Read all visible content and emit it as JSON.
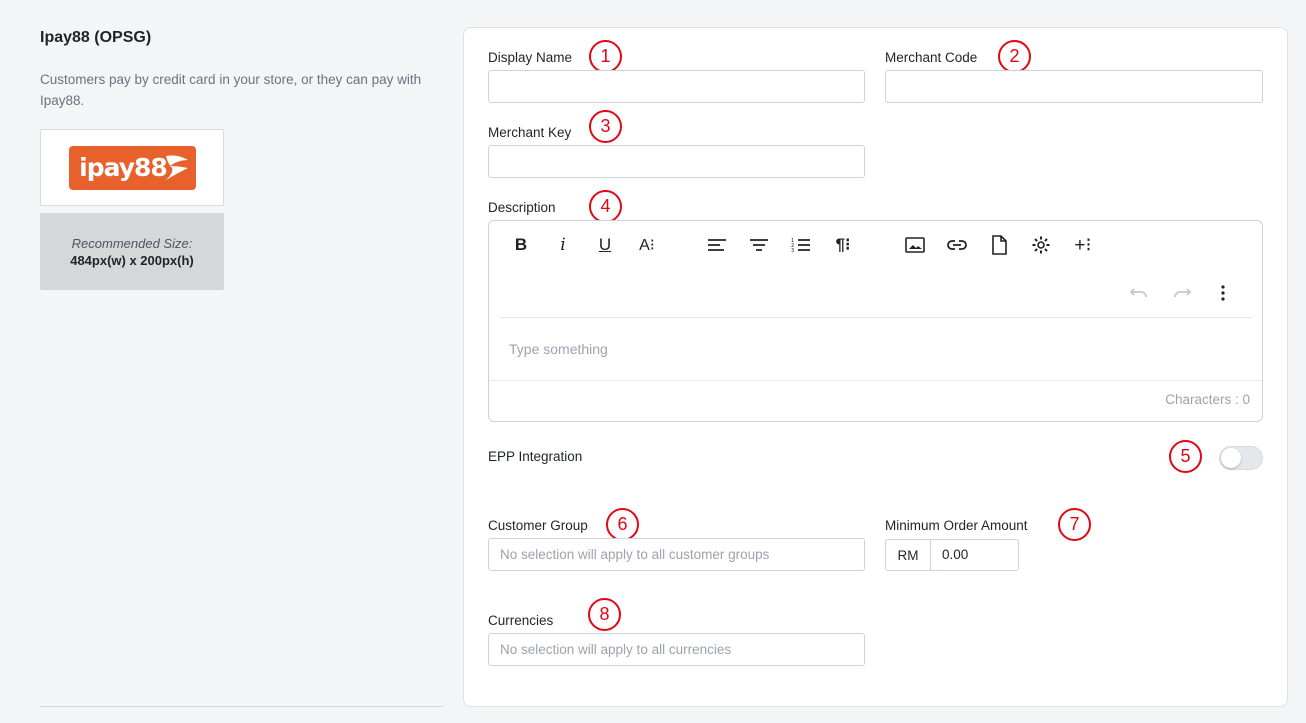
{
  "payment_method": {
    "title": "Ipay88 (OPSG)",
    "description": "Customers pay by credit card in your store, or they can pay with Ipay88.",
    "logo_text": "ipay88",
    "recommended_label": "Recommended Size:",
    "recommended_value": "484px(w) x 200px(h)"
  },
  "form": {
    "display_name": {
      "label": "Display Name",
      "value": ""
    },
    "merchant_code": {
      "label": "Merchant Code",
      "value": ""
    },
    "merchant_key": {
      "label": "Merchant Key",
      "value": ""
    },
    "description": {
      "label": "Description",
      "placeholder": "Type something",
      "characters": "Characters : 0"
    },
    "epp_integration": {
      "label": "EPP Integration",
      "enabled": false
    },
    "customer_group": {
      "label": "Customer Group",
      "placeholder": "No selection will apply to all customer groups"
    },
    "minimum_order_amount": {
      "label": "Minimum Order Amount",
      "prefix": "RM",
      "value": "0.00"
    },
    "currencies": {
      "label": "Currencies",
      "placeholder": "No selection will apply to all currencies"
    }
  },
  "toolbar": {
    "bold": "B",
    "italic": "i",
    "underline": "U",
    "font_size": "A⁝",
    "paragraph": "¶⁝",
    "insert_more": "+⁝"
  },
  "markers": [
    "1",
    "2",
    "3",
    "4",
    "5",
    "6",
    "7",
    "8"
  ],
  "colors": {
    "marker": "#e30613",
    "logo": "#e8602c"
  }
}
